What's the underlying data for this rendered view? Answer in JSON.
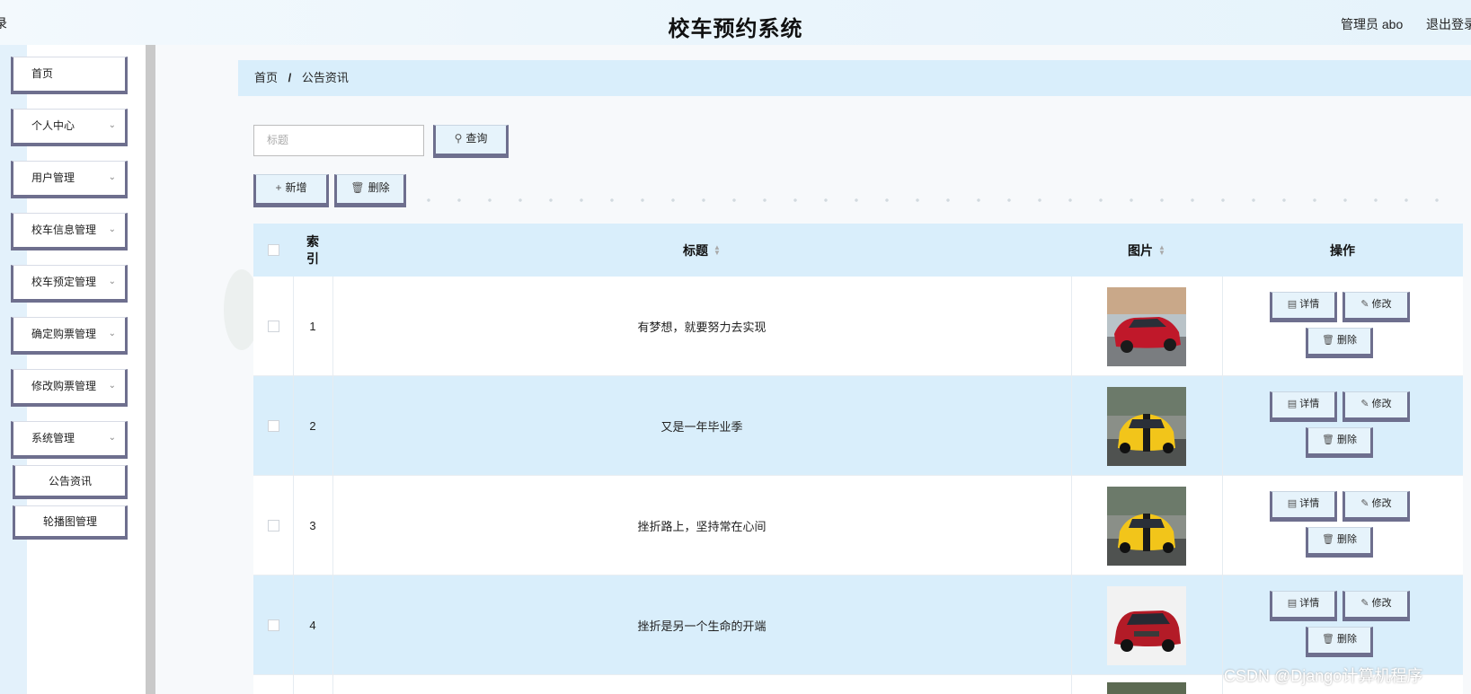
{
  "header": {
    "left_fragment": "录",
    "title": "校车预约系统",
    "user": "管理员 abo",
    "logout": "退出登录"
  },
  "sidebar": {
    "items": [
      {
        "label": "首页"
      },
      {
        "label": "个人中心"
      },
      {
        "label": "用户管理"
      },
      {
        "label": "校车信息管理"
      },
      {
        "label": "校车预定管理"
      },
      {
        "label": "确定购票管理"
      },
      {
        "label": "修改购票管理"
      },
      {
        "label": "系统管理"
      }
    ],
    "sub_items": [
      {
        "label": "公告资讯"
      },
      {
        "label": "轮播图管理"
      }
    ]
  },
  "breadcrumb": {
    "home": "首页",
    "sep": "/",
    "current": "公告资讯"
  },
  "search": {
    "placeholder": "标题",
    "button": "查询"
  },
  "toolbar": {
    "add": "新增",
    "delete": "删除"
  },
  "table": {
    "headers": {
      "index": "索引",
      "title": "标题",
      "image": "图片",
      "actions": "操作"
    },
    "rows": [
      {
        "index": "1",
        "title": "有梦想，就要努力去实现",
        "image": "red-sedan"
      },
      {
        "index": "2",
        "title": "又是一年毕业季",
        "image": "yellow-sports-car"
      },
      {
        "index": "3",
        "title": "挫折路上，坚持常在心间",
        "image": "yellow-sports-car"
      },
      {
        "index": "4",
        "title": "挫折是另一个生命的开端",
        "image": "red-suv"
      }
    ],
    "row_actions": {
      "detail": "详情",
      "edit": "修改",
      "delete": "删除"
    }
  },
  "watermark": "CSDN @Django计算机程序",
  "colors": {
    "accent_blue": "#d9eefb",
    "button_border": "#6e6f8e"
  }
}
